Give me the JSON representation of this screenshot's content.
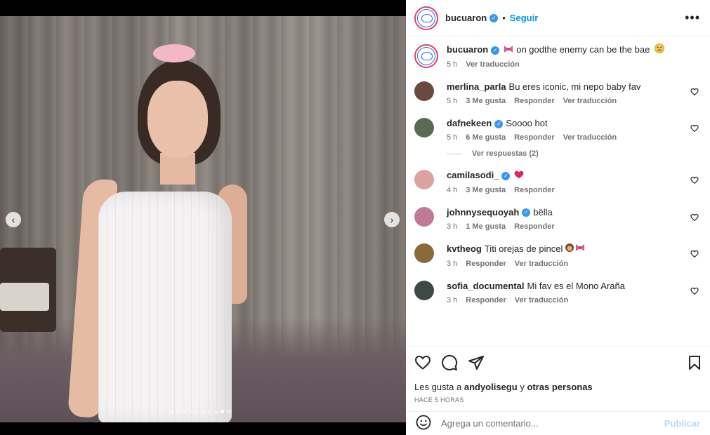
{
  "header": {
    "username": "bucuaron",
    "separator": "•",
    "follow_label": "Seguir",
    "more_label": "•••"
  },
  "caption": {
    "username": "bucuaron",
    "text": "on godthe enemy can be the bae",
    "time": "5 h",
    "translate": "Ver traducción"
  },
  "comments": [
    {
      "user": "merlina_parla",
      "text": "Bu eres iconic, mi nepo baby fav",
      "time": "5 h",
      "likes": "3 Me gusta",
      "reply": "Responder",
      "translate": "Ver traducción",
      "verified": false,
      "avatar_color": "#6b4a3d"
    },
    {
      "user": "dafnekeen",
      "text": "Soooo hot",
      "time": "5 h",
      "likes": "6 Me gusta",
      "reply": "Responder",
      "translate": "Ver traducción",
      "verified": true,
      "avatar_color": "#5a6b52",
      "replies_label": "Ver respuestas (2)"
    },
    {
      "user": "camilasodi_",
      "text": "",
      "time": "4 h",
      "likes": "3 Me gusta",
      "reply": "Responder",
      "translate": "",
      "verified": true,
      "avatar_color": "#d9a4a0"
    },
    {
      "user": "johnnysequoyah",
      "text": "bëlla",
      "time": "3 h",
      "likes": "1 Me gusta",
      "reply": "Responder",
      "translate": "",
      "verified": true,
      "avatar_color": "#c07a96"
    },
    {
      "user": "kvtheog",
      "text": "Titi orejas de pincel",
      "time": "3 h",
      "likes": "",
      "reply": "Responder",
      "translate": "Ver traducción",
      "verified": false,
      "avatar_color": "#8a6a3a"
    },
    {
      "user": "sofia_documental",
      "text": "Mi fav es el Mono Araña",
      "time": "3 h",
      "likes": "",
      "reply": "Responder",
      "translate": "Ver traducción",
      "verified": false,
      "avatar_color": "#3d4a44"
    }
  ],
  "footer": {
    "likes_prefix": "Les gusta a",
    "likes_user": "andyolisegu",
    "likes_conj": "y",
    "likes_others": "otras personas",
    "time_ago": "HACE 5 HORAS",
    "comment_placeholder": "Agrega un comentario...",
    "publish_label": "Publicar"
  },
  "carousel": {
    "total_dots": 10,
    "active_index": 8
  },
  "colors": {
    "accent": "#0095f6",
    "publish_disabled": "#b3dbff",
    "verified": "#3897f0"
  }
}
